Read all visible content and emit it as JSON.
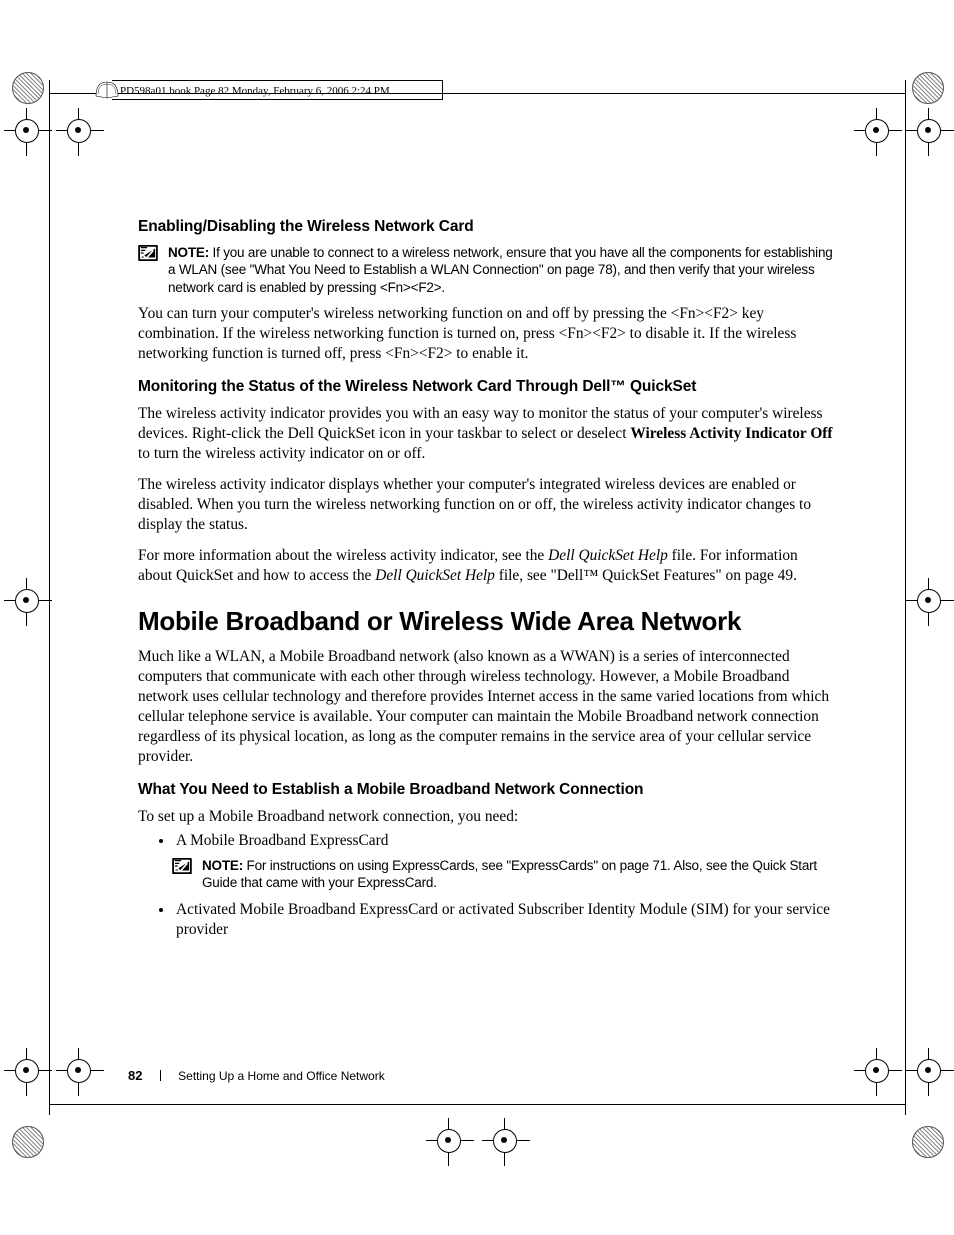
{
  "running_head": "PD598a01.book  Page 82  Monday, February 6, 2006  2:24 PM",
  "section1": {
    "heading": "Enabling/Disabling the Wireless Network Card",
    "note_label": "NOTE:",
    "note_text": " If you are unable to connect to a wireless network, ensure that you have all the components for establishing a WLAN (see \"What You Need to Establish a WLAN Connection\" on page 78), and then verify that your wireless network card is enabled by pressing <Fn><F2>.",
    "para1": "You can turn your computer's wireless networking function on and off by pressing the <Fn><F2> key combination. If the wireless networking function is turned on, press <Fn><F2> to disable it. If the wireless networking function is turned off, press <Fn><F2> to enable it."
  },
  "section2": {
    "heading": "Monitoring the Status of the Wireless Network Card Through Dell™ QuickSet",
    "para1_a": "The wireless activity indicator provides you with an easy way to monitor the status of your computer's wireless devices. Right-click the Dell QuickSet icon in your taskbar to select or deselect ",
    "para1_bold": "Wireless Activity Indicator Off",
    "para1_b": " to turn the wireless activity indicator on or off.",
    "para2": "The wireless activity indicator displays whether your computer's integrated wireless devices are enabled or disabled. When you turn the wireless networking function on or off, the wireless activity indicator changes to display the status.",
    "para3_a": "For more information about the wireless activity indicator, see the ",
    "para3_i1": "Dell QuickSet Help",
    "para3_b": " file. For information about QuickSet and how to access the ",
    "para3_i2": "Dell QuickSet Help",
    "para3_c": " file, see \"Dell™ QuickSet Features\" on page 49."
  },
  "section3": {
    "heading": "Mobile Broadband or Wireless Wide Area Network",
    "para1": "Much like a WLAN, a Mobile Broadband network (also known as a WWAN) is a series of interconnected computers that communicate with each other through wireless technology. However, a Mobile Broadband network uses cellular technology and therefore provides Internet access in the same varied locations from which cellular telephone service is available. Your computer can maintain the Mobile Broadband network connection regardless of its physical location, as long as the computer remains in the service area of your cellular service provider."
  },
  "section4": {
    "heading": "What You Need to Establish a Mobile Broadband Network Connection",
    "para1": "To set up a Mobile Broadband network connection, you need:",
    "bullet1": "A Mobile Broadband ExpressCard",
    "note_label": "NOTE:",
    "note_text": " For instructions on using ExpressCards, see \"ExpressCards\" on page 71. Also, see the Quick Start Guide that came with your ExpressCard.",
    "bullet2": "Activated Mobile Broadband ExpressCard or activated Subscriber Identity Module (SIM) for your service provider"
  },
  "footer": {
    "page_number": "82",
    "chapter": "Setting Up a Home and Office Network"
  }
}
